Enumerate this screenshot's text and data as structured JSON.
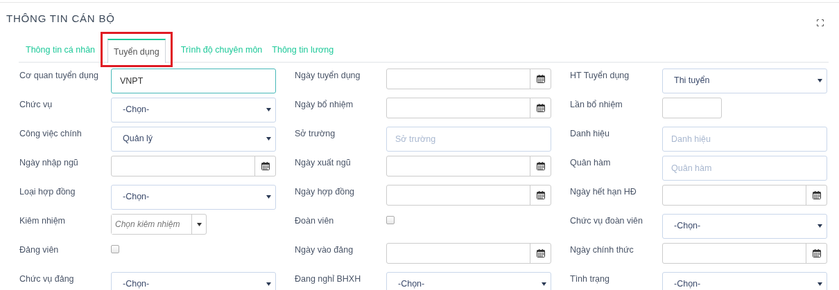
{
  "panel": {
    "title": "THÔNG TIN CÁN BỘ"
  },
  "tabs": [
    {
      "label": "Thông tin cá nhân",
      "selected": false,
      "highlighted": false
    },
    {
      "label": "Tuyển dụng",
      "selected": true,
      "highlighted": true
    },
    {
      "label": "Trình độ chuyên môn",
      "selected": false,
      "highlighted": false
    },
    {
      "label": "Thông tin lương",
      "selected": false,
      "highlighted": false
    }
  ],
  "fields": [
    {
      "label": "Cơ quan tuyển dụng",
      "kind": "text",
      "value": "VNPT",
      "focused": true
    },
    {
      "label": "Ngày tuyển dụng",
      "kind": "date"
    },
    {
      "label": "HT Tuyển dụng",
      "kind": "select",
      "value": "Thi tuyển"
    },
    {
      "label": "Chức vụ",
      "kind": "select",
      "value": "-Chọn-"
    },
    {
      "label": "Ngày bổ nhiệm",
      "kind": "date"
    },
    {
      "label": "Lần bổ nhiệm",
      "kind": "short"
    },
    {
      "label": "Công việc chính",
      "kind": "select",
      "value": "Quản lý"
    },
    {
      "label": "Sở trường",
      "kind": "text",
      "placeholder": "Sở trường",
      "focused": false
    },
    {
      "label": "Danh hiệu",
      "kind": "text",
      "placeholder": "Danh hiệu",
      "focused": false
    },
    {
      "label": "Ngày nhập ngũ",
      "kind": "date"
    },
    {
      "label": "Ngày xuất ngũ",
      "kind": "date"
    },
    {
      "label": "Quân hàm",
      "kind": "text",
      "placeholder": "Quân hàm",
      "focused": false
    },
    {
      "label": "Loại hợp đồng",
      "kind": "select",
      "value": "-Chọn-"
    },
    {
      "label": "Ngày hợp đồng",
      "kind": "date"
    },
    {
      "label": "Ngày hết hạn HĐ",
      "kind": "date"
    },
    {
      "label": "Kiêm nhiệm",
      "kind": "combo",
      "placeholder": "Chọn kiêm nhiệm"
    },
    {
      "label": "Đoàn viên",
      "kind": "checkbox",
      "checked": false
    },
    {
      "label": "Chức vụ đoàn viên",
      "kind": "select",
      "value": "-Chọn-"
    },
    {
      "label": "Đảng viên",
      "kind": "checkbox",
      "checked": false
    },
    {
      "label": "Ngày vào đảng",
      "kind": "date"
    },
    {
      "label": "Ngày chính thức",
      "kind": "date"
    },
    {
      "label": "Chức vụ đảng",
      "kind": "select",
      "value": "-Chọn-"
    },
    {
      "label": "Đang nghỉ BHXH",
      "kind": "select",
      "value": "-Chọn-"
    },
    {
      "label": "Tình trạng",
      "kind": "select",
      "value": "-Chọn-"
    }
  ]
}
